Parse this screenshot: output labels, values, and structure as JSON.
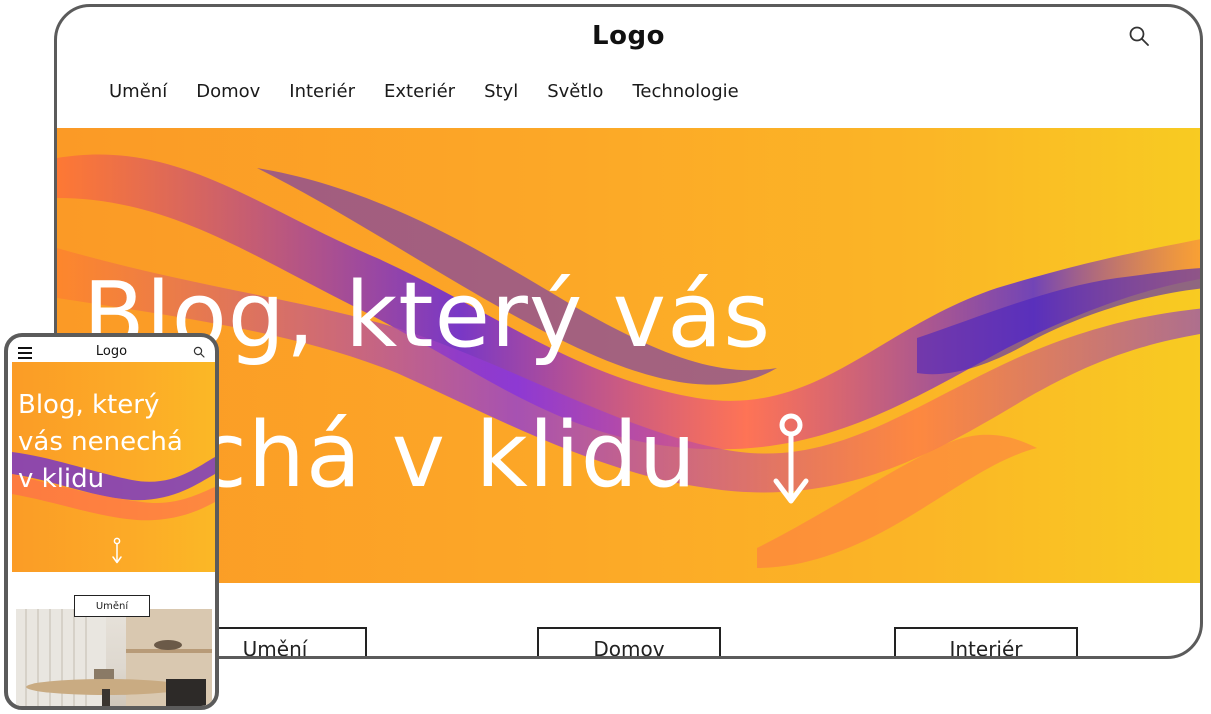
{
  "desktop": {
    "logo": "Logo",
    "nav": [
      "Umění",
      "Domov",
      "Interiér",
      "Exteriér",
      "Styl",
      "Světlo",
      "Technologie"
    ],
    "hero": {
      "line1": "Blog, který vás",
      "line2": "nechá v klidu"
    },
    "categories": [
      "Umění",
      "Domov",
      "Interiér"
    ]
  },
  "mobile": {
    "logo": "Logo",
    "hero": {
      "line1": "Blog, který",
      "line2": "vás nenechá",
      "line3": "v klidu"
    },
    "category": "Umění"
  },
  "icons": {
    "search": "search-icon",
    "menu": "hamburger-menu-icon",
    "arrow": "scroll-down-arrow-icon"
  },
  "colors": {
    "accent_orange": "#fca827",
    "accent_yellow": "#f8cb22",
    "accent_purple": "#6a2bd8",
    "frame_border": "#5b5b5b"
  }
}
